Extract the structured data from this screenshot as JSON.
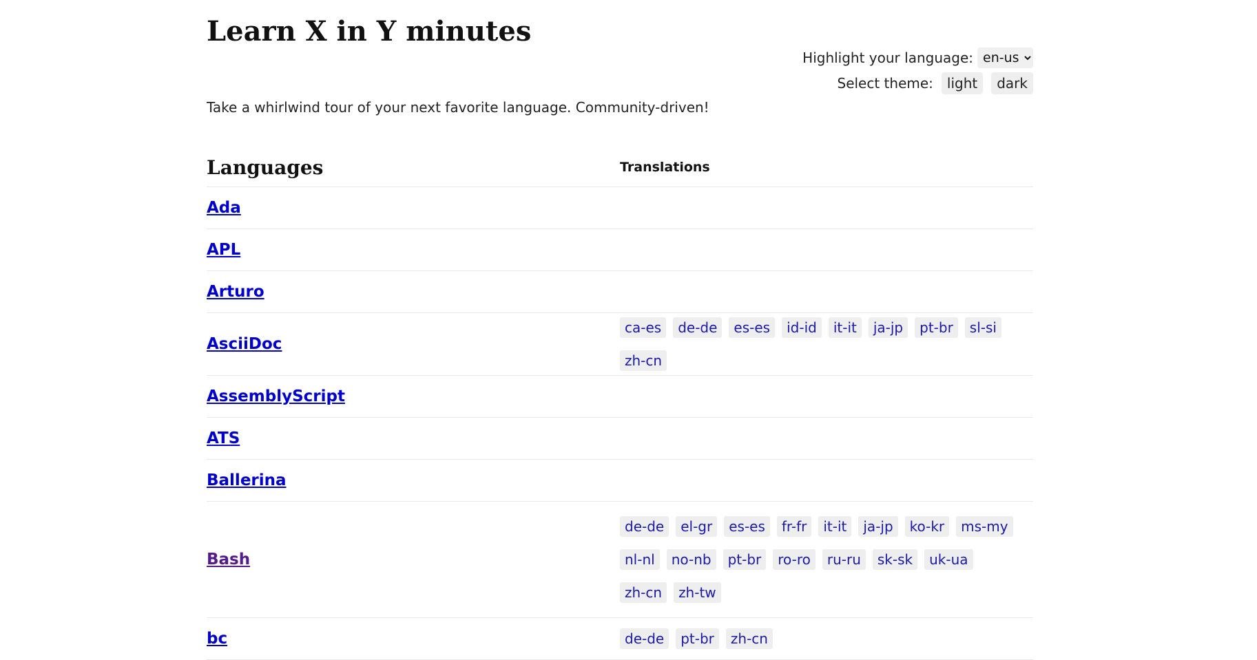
{
  "site": {
    "title": "Learn X in Y minutes",
    "tagline": "Take a whirlwind tour of your next favorite language. Community-driven!"
  },
  "controls": {
    "language_label": "Highlight your language:",
    "language_value": "en-us",
    "theme_label": "Select theme:",
    "theme_light": "light",
    "theme_dark": "dark"
  },
  "table": {
    "languages_header": "Languages",
    "translations_header": "Translations"
  },
  "languages": [
    {
      "name": "Ada",
      "visited": false,
      "translations": []
    },
    {
      "name": "APL",
      "visited": false,
      "translations": []
    },
    {
      "name": "Arturo",
      "visited": false,
      "translations": []
    },
    {
      "name": "AsciiDoc",
      "visited": false,
      "translations": [
        "ca-es",
        "de-de",
        "es-es",
        "id-id",
        "it-it",
        "ja-jp",
        "pt-br",
        "sl-si",
        "zh-cn"
      ]
    },
    {
      "name": "AssemblyScript",
      "visited": false,
      "translations": []
    },
    {
      "name": "ATS",
      "visited": false,
      "translations": []
    },
    {
      "name": "Ballerina",
      "visited": false,
      "translations": []
    },
    {
      "name": "Bash",
      "visited": true,
      "translations": [
        "de-de",
        "el-gr",
        "es-es",
        "fr-fr",
        "it-it",
        "ja-jp",
        "ko-kr",
        "ms-my",
        "nl-nl",
        "no-nb",
        "pt-br",
        "ro-ro",
        "ru-ru",
        "sk-sk",
        "uk-ua",
        "zh-cn",
        "zh-tw"
      ]
    },
    {
      "name": "bc",
      "visited": false,
      "translations": [
        "de-de",
        "pt-br",
        "zh-cn"
      ]
    }
  ],
  "colors": {
    "link": "#0000cc",
    "visited_link": "#551a8b",
    "tag_bg": "#eeeeee"
  }
}
